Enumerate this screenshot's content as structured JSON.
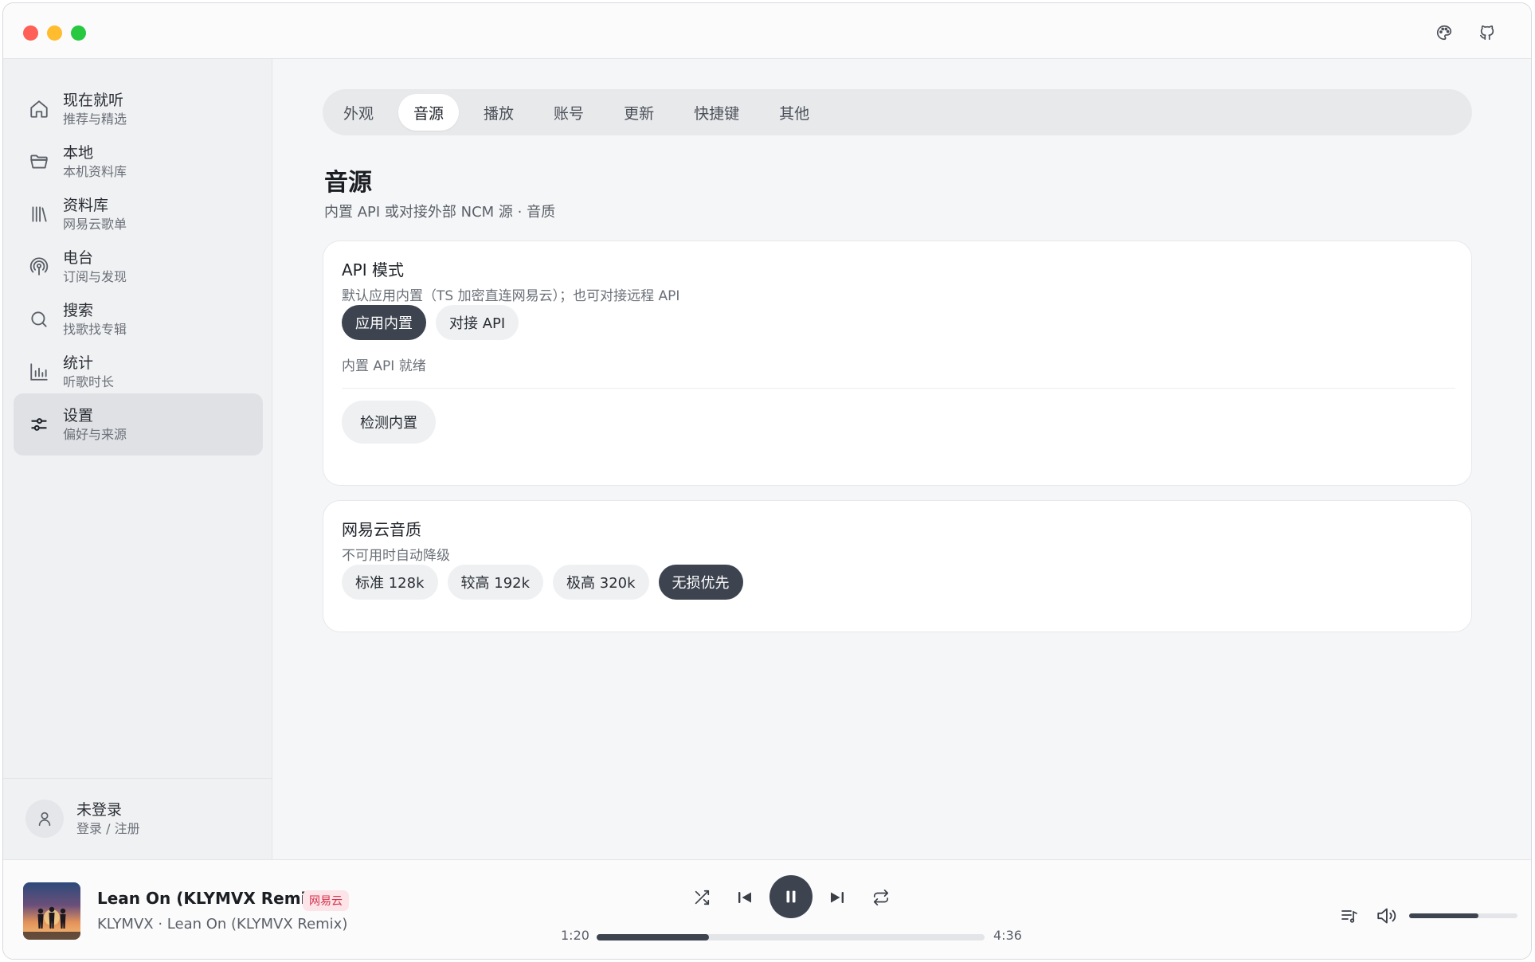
{
  "sidebar": {
    "items": [
      {
        "title": "现在就听",
        "sub": "推荐与精选",
        "icon": "home-icon"
      },
      {
        "title": "本地",
        "sub": "本机资料库",
        "icon": "folder-icon"
      },
      {
        "title": "资料库",
        "sub": "网易云歌单",
        "icon": "library-icon"
      },
      {
        "title": "电台",
        "sub": "订阅与发现",
        "icon": "podcast-icon"
      },
      {
        "title": "搜索",
        "sub": "找歌找专辑",
        "icon": "search-icon"
      },
      {
        "title": "统计",
        "sub": "听歌时长",
        "icon": "stats-icon"
      },
      {
        "title": "设置",
        "sub": "偏好与来源",
        "icon": "settings-sliders-icon",
        "active": true
      }
    ],
    "user": {
      "name": "未登录",
      "sub": "登录 / 注册"
    }
  },
  "titlebar": {
    "icons": [
      "palette-icon",
      "github-icon"
    ]
  },
  "tabs": [
    {
      "label": "外观"
    },
    {
      "label": "音源",
      "active": true
    },
    {
      "label": "播放"
    },
    {
      "label": "账号"
    },
    {
      "label": "更新"
    },
    {
      "label": "快捷键"
    },
    {
      "label": "其他"
    }
  ],
  "page": {
    "title": "音源",
    "subtitle": "内置 API 或对接外部 NCM 源 · 音质"
  },
  "api_card": {
    "title": "API 模式",
    "desc": "默认应用内置（TS 加密直连网易云）；也可对接远程 API",
    "options": [
      {
        "label": "应用内置",
        "active": true
      },
      {
        "label": "对接 API",
        "active": false
      }
    ],
    "status": "内置 API 就绪",
    "check_button": "检测内置"
  },
  "quality_card": {
    "title": "网易云音质",
    "desc": "不可用时自动降级",
    "options": [
      {
        "label": "标准 128k",
        "active": false
      },
      {
        "label": "较高 192k",
        "active": false
      },
      {
        "label": "极高 320k",
        "active": false
      },
      {
        "label": "无损优先",
        "active": true
      }
    ]
  },
  "player": {
    "title": "Lean On (KLYMVX Remix)",
    "tag": "网易云",
    "artist_line": "KLYMVX · Lean On (KLYMVX Remix)",
    "current_time": "1:20",
    "total_time": "4:36",
    "progress_fraction": 0.29,
    "volume_fraction": 0.64,
    "accent_color": "#3d4450",
    "tag_color": "#d5344d"
  }
}
